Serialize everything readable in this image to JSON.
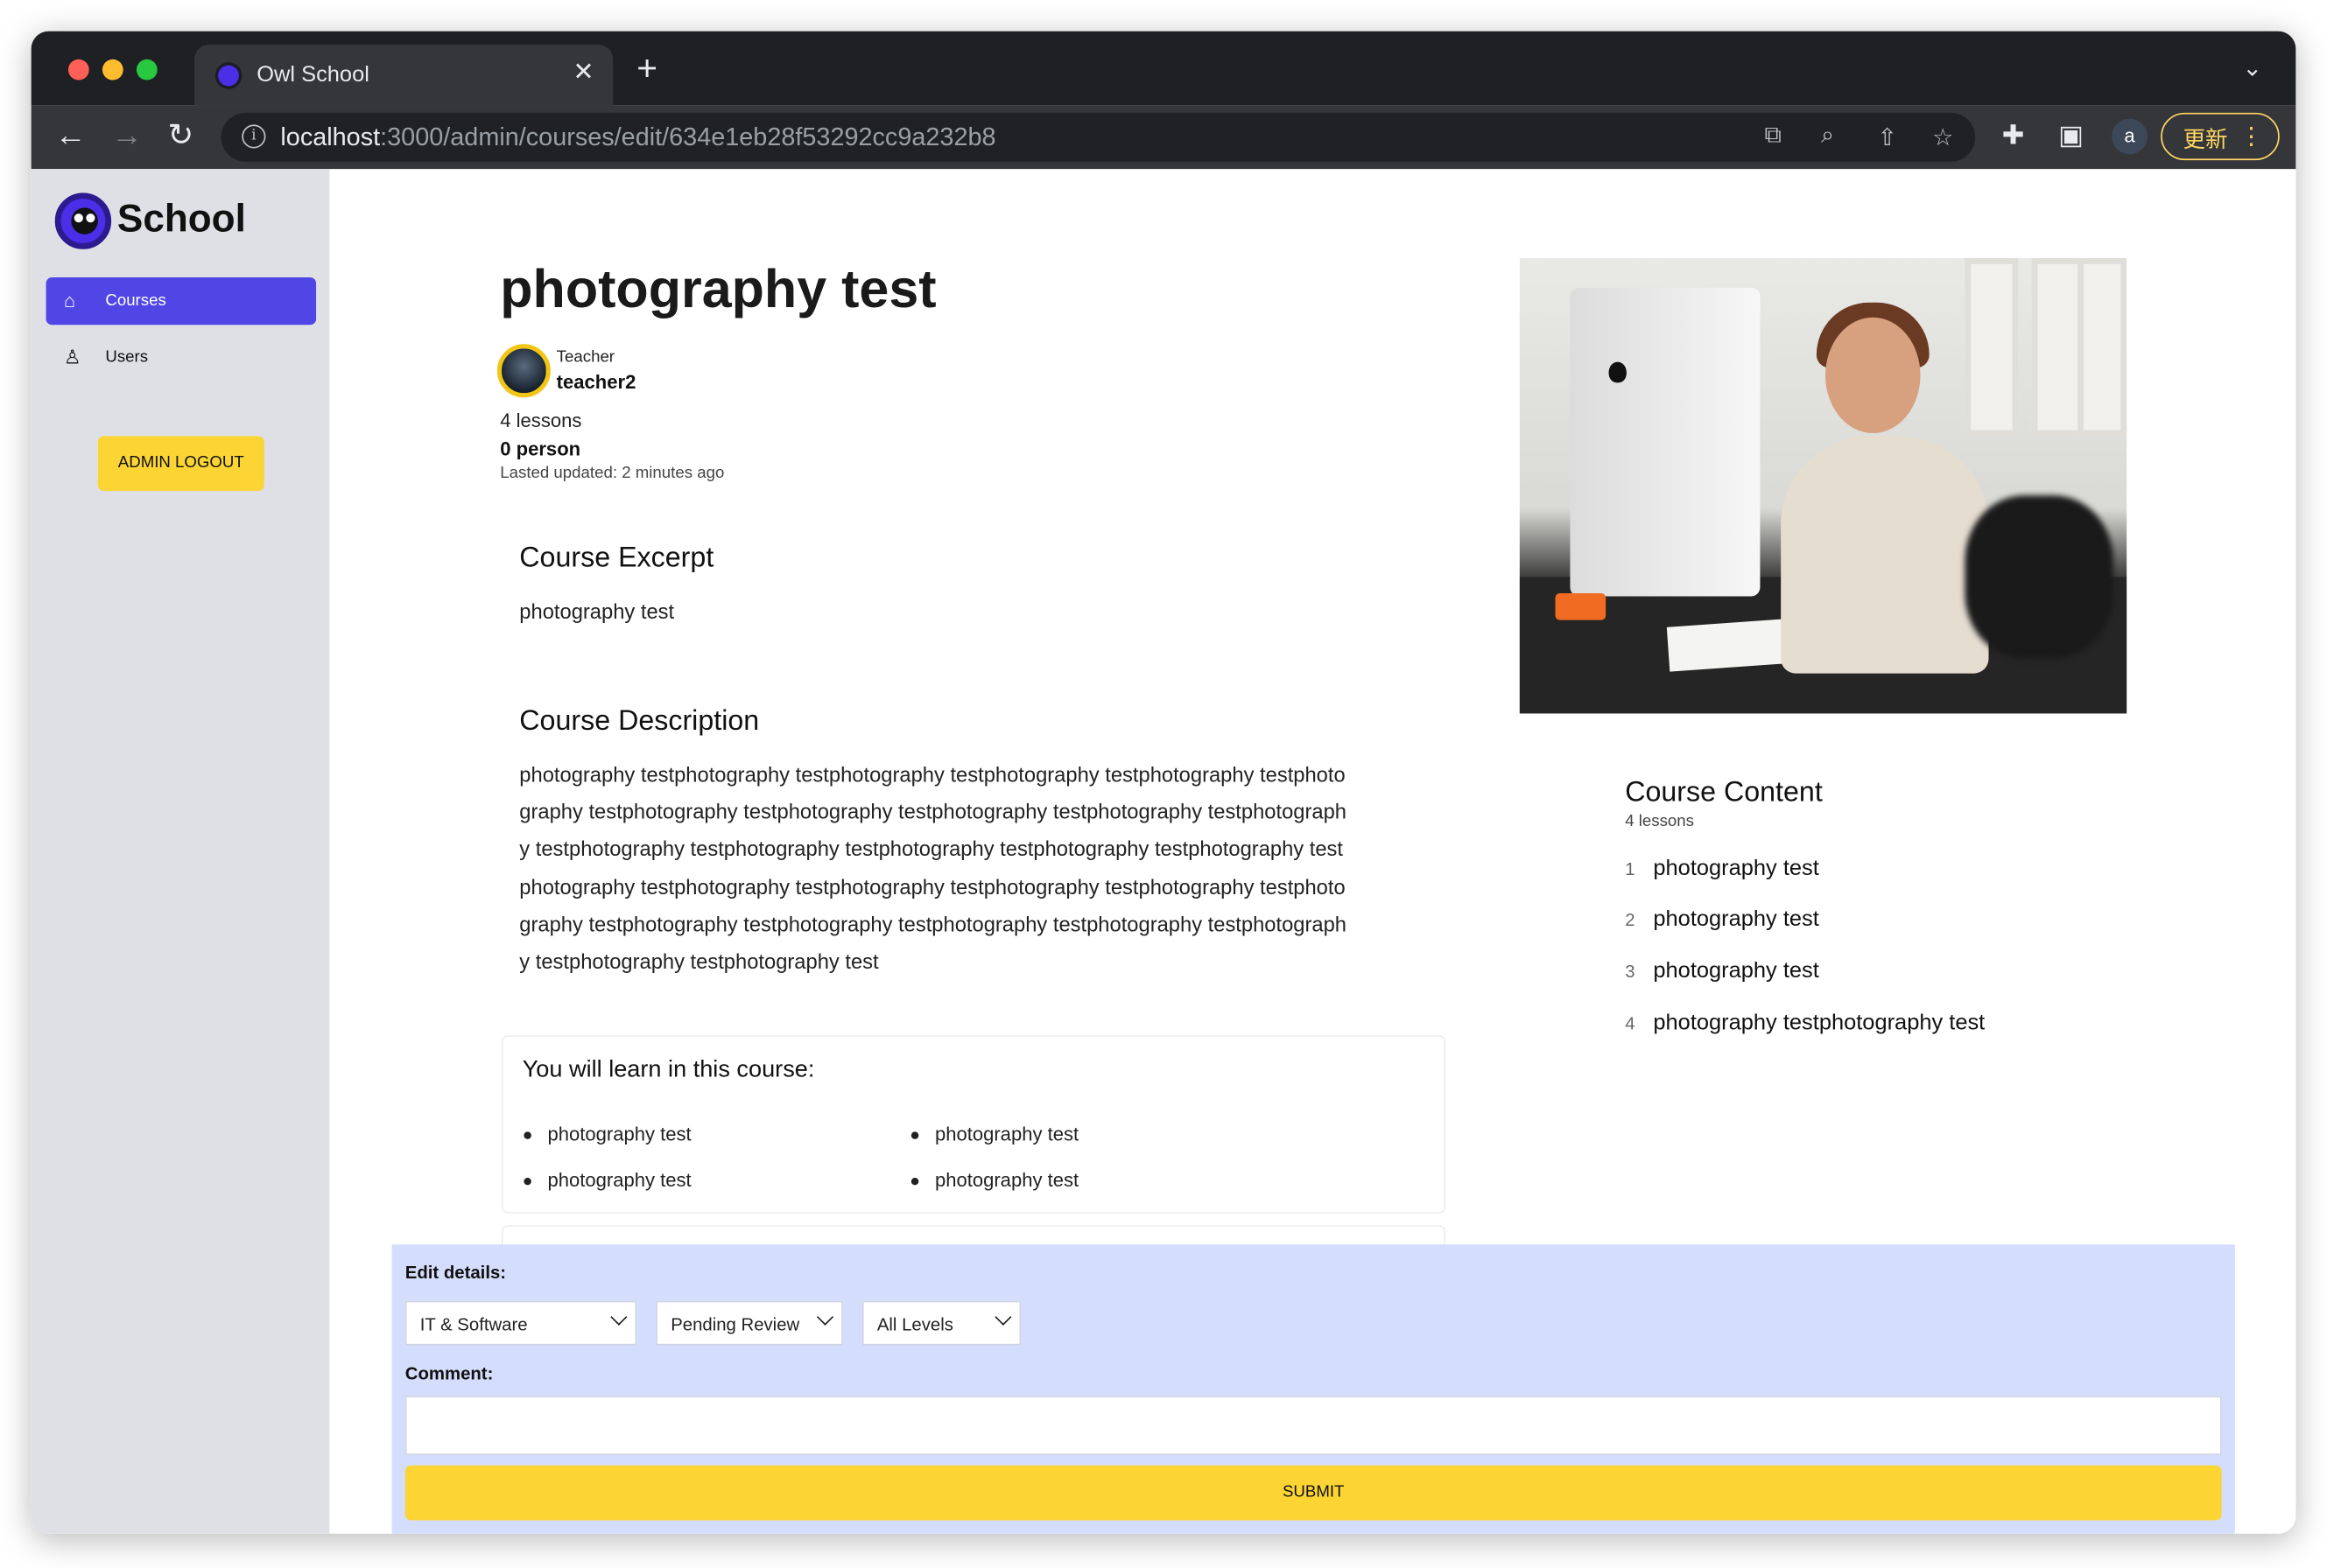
{
  "browser": {
    "tab_title": "Owl School",
    "tab_close": "✕",
    "new_tab": "+",
    "url_host": "localhost",
    "url_rest": ":3000/admin/courses/edit/634e1eb28f53292cc9a232b8",
    "profile_initial": "a",
    "update_label": "更新"
  },
  "sidebar": {
    "logo_text": "School",
    "items": [
      {
        "label": "Courses",
        "icon": "home-icon"
      },
      {
        "label": "Users",
        "icon": "user-icon"
      }
    ],
    "logout_label": "ADMIN LOGOUT"
  },
  "course": {
    "title": "photography test",
    "teacher_label": "Teacher",
    "teacher_name": "teacher2",
    "lessons_count": "4 lessons",
    "enrolled": "0 person",
    "updated": "Lasted updated: 2 minutes ago",
    "excerpt_heading": "Course Excerpt",
    "excerpt": "photography test",
    "description_heading": "Course Description",
    "description": "photography testphotography testphotography testphotography testphotography testphotography testphotography testphotography testphotography testphotography testphotography testphotography testphotography testphotography testphotography testphotography testphotography testphotography testphotography testphotography testphotography testphotography testphotography testphotography testphotography testphotography testphotography testphotography testphotography test",
    "learn_heading": "You will learn in this course:",
    "learn_items": [
      "photography test",
      "photography test",
      "photography test",
      "photography test"
    ]
  },
  "content": {
    "heading": "Course Content",
    "subheading": "4 lessons",
    "lessons": [
      {
        "num": "1",
        "title": "photography test"
      },
      {
        "num": "2",
        "title": "photography test"
      },
      {
        "num": "3",
        "title": "photography test"
      },
      {
        "num": "4",
        "title": "photography testphotography test"
      }
    ]
  },
  "edit": {
    "label": "Edit details:",
    "category": "IT & Software",
    "status": "Pending Review",
    "level": "All Levels",
    "comment_label": "Comment:",
    "comment_value": "",
    "submit_label": "SUBMIT"
  },
  "colors": {
    "accent": "#4f46e5",
    "yellow": "#fcd535",
    "sidebar": "#dfe0e6",
    "editbar": "#d4ddfc"
  }
}
